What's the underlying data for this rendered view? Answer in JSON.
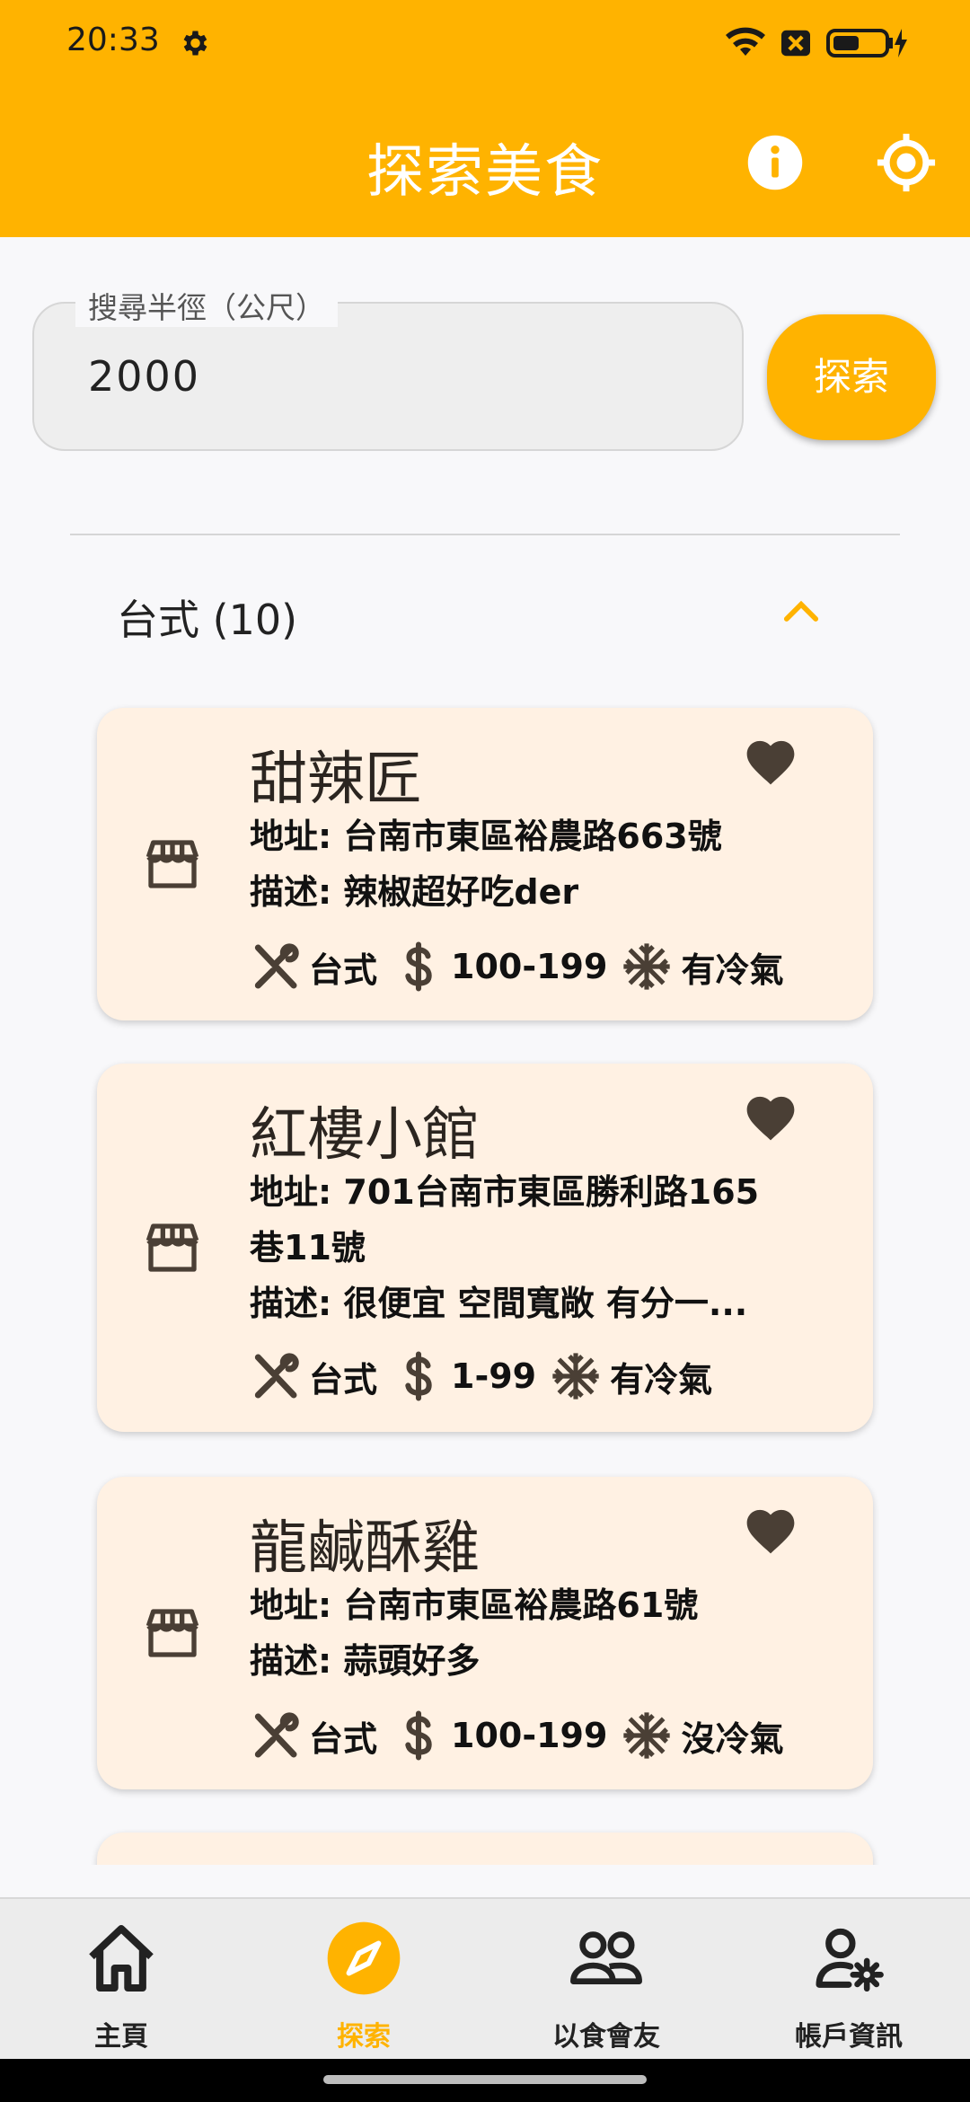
{
  "status_bar": {
    "time": "20:33"
  },
  "app_bar": {
    "title": "探索美食"
  },
  "search": {
    "label": "搜尋半徑（公尺）",
    "value": "2000",
    "button": "探索"
  },
  "section": {
    "title": "台式 (10)"
  },
  "restaurants": [
    {
      "name": "甜辣匠",
      "address_line1": "地址: 台南市東區裕農路663號",
      "address_line2": "",
      "description": "描述: 辣椒超好吃der",
      "cuisine": "台式",
      "price": "100-199",
      "aircon": "有冷氣"
    },
    {
      "name": "紅樓小館",
      "address_line1": "地址: 701台南市東區勝利路165",
      "address_line2": "巷11號",
      "description": "描述: 很便宜 空間寬敞 有分一...",
      "cuisine": "台式",
      "price": "1-99",
      "aircon": "有冷氣"
    },
    {
      "name": "龍鹹酥雞",
      "address_line1": "地址: 台南市東區裕農路61號",
      "address_line2": "",
      "description": "描述: 蒜頭好多",
      "cuisine": "台式",
      "price": "100-199",
      "aircon": "沒冷氣"
    }
  ],
  "bottom_nav": {
    "items": [
      {
        "label": "主頁",
        "icon": "home-icon"
      },
      {
        "label": "探索",
        "icon": "compass-icon"
      },
      {
        "label": "以食會友",
        "icon": "people-icon"
      },
      {
        "label": "帳戶資訊",
        "icon": "account-settings-icon"
      }
    ],
    "active_index": 1
  },
  "colors": {
    "primary": "#ffb300",
    "card": "#fff1e3",
    "icon": "#4a3f35"
  }
}
